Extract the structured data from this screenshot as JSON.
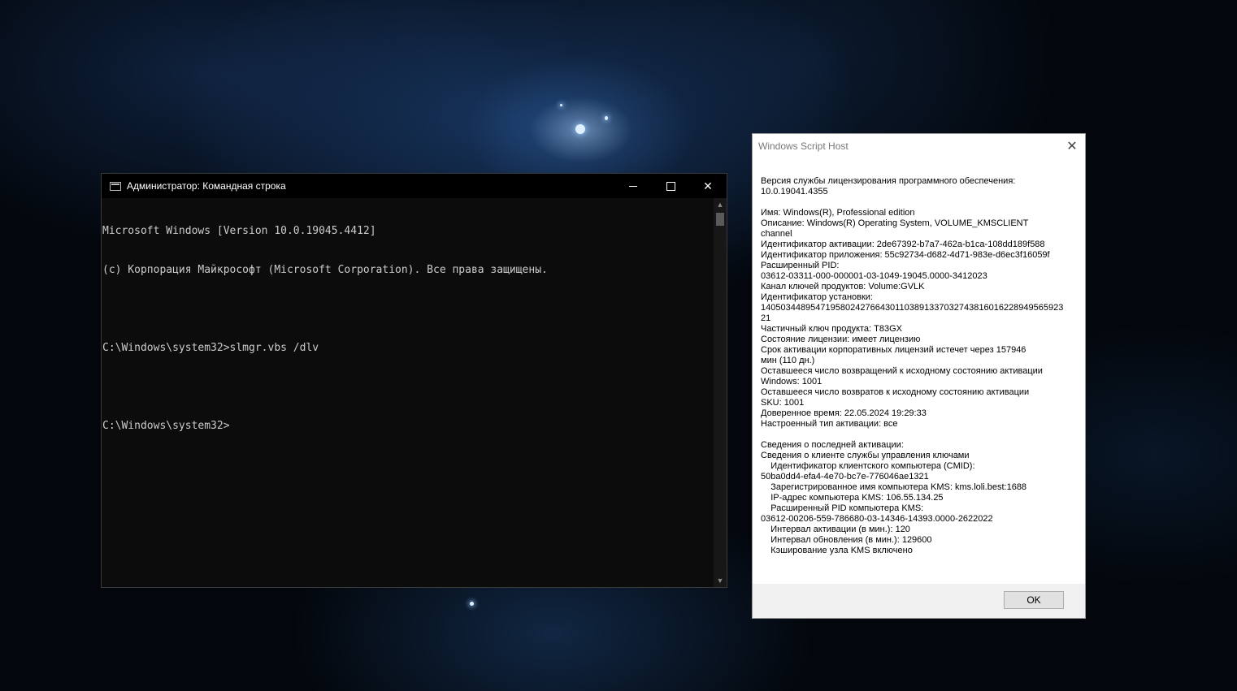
{
  "cmd": {
    "title": "Администратор: Командная строка",
    "lines": [
      "Microsoft Windows [Version 10.0.19045.4412]",
      "(c) Корпорация Майкрософт (Microsoft Corporation). Все права защищены.",
      "",
      "C:\\Windows\\system32>slmgr.vbs /dlv",
      "",
      "C:\\Windows\\system32>"
    ]
  },
  "dialog": {
    "title": "Windows Script Host",
    "ok_label": "OK",
    "lines": [
      "Версия службы лицензирования программного обеспечения:",
      "10.0.19041.4355",
      "",
      "Имя: Windows(R), Professional edition",
      "Описание: Windows(R) Operating System, VOLUME_KMSCLIENT",
      "channel",
      "Идентификатор активации: 2de67392-b7a7-462a-b1ca-108dd189f588",
      "Идентификатор приложения: 55c92734-d682-4d71-983e-d6ec3f16059f",
      "Расширенный PID:",
      "03612-03311-000-000001-03-1049-19045.0000-3412023",
      "Канал ключей продуктов: Volume:GVLK",
      "Идентификатор установки:",
      "1405034489547195802427664301103891337032743816016228949565923",
      "21",
      "Частичный ключ продукта: T83GX",
      "Состояние лицензии: имеет лицензию",
      "Срок активации корпоративных лицензий истечет через 157946",
      "мин (110 дн.)",
      "Оставшееся число возвращений к исходному состоянию активации",
      "Windows: 1001",
      "Оставшееся число возвратов к исходному состоянию активации",
      "SKU: 1001",
      "Доверенное время: 22.05.2024 19:29:33",
      "Настроенный тип активации: все",
      "",
      "Сведения о последней активации:",
      "Сведения о клиенте службы управления ключами",
      "    Идентификатор клиентского компьютера (CMID):",
      "50ba0dd4-efa4-4e70-bc7e-776046ae1321",
      "    Зарегистрированное имя компьютера KMS: kms.loli.best:1688",
      "    IP-адрес компьютера KMS: 106.55.134.25",
      "    Расширенный PID компьютера KMS:",
      "03612-00206-559-786680-03-14346-14393.0000-2622022",
      "    Интервал активации (в мин.): 120",
      "    Интервал обновления (в мин.): 129600",
      "    Кэширование узла KMS включено"
    ]
  }
}
